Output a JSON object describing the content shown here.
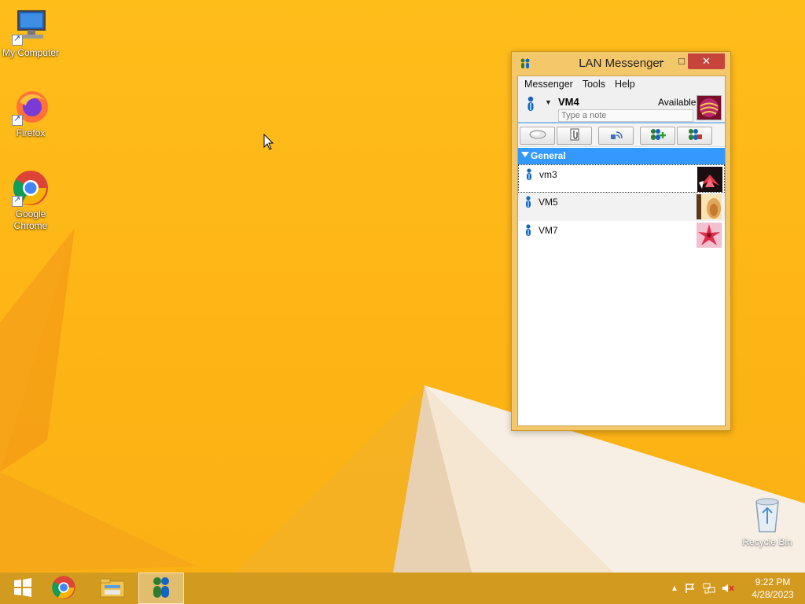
{
  "desktop": {
    "icons": [
      {
        "label": "My Computer",
        "icon": "computer-icon"
      },
      {
        "label": "Firefox",
        "icon": "firefox-icon"
      },
      {
        "label": "Google Chrome",
        "icon": "chrome-icon"
      }
    ],
    "recycle_bin": {
      "label": "Recycle Bin",
      "icon": "recycle-bin-icon"
    }
  },
  "window": {
    "title": "LAN Messenger",
    "controls": {
      "minimize": "–",
      "maximize": "□",
      "close": "✕"
    },
    "menu": [
      "Messenger",
      "Tools",
      "Help"
    ],
    "profile": {
      "name": "VM4",
      "status": "Available",
      "note_placeholder": "Type a note",
      "dropdown": "▼"
    },
    "toolbar_buttons": [
      {
        "icon": "chat-icon"
      },
      {
        "icon": "send-file-icon"
      },
      {
        "icon": "broadcast-icon"
      },
      {
        "icon": "add-contact-icon"
      },
      {
        "icon": "contacts-settings-icon"
      }
    ],
    "group": {
      "name": "General",
      "expanded": true
    },
    "contacts": [
      {
        "name": "vm3",
        "selected": true
      },
      {
        "name": "VM5",
        "selected": false
      },
      {
        "name": "VM7",
        "selected": false
      }
    ]
  },
  "taskbar": {
    "items": [
      {
        "icon": "start-icon"
      },
      {
        "icon": "chrome-icon"
      },
      {
        "icon": "file-explorer-icon"
      },
      {
        "icon": "lan-messenger-icon",
        "active": true
      }
    ],
    "tray": [
      "chevron-up-icon",
      "flag-icon",
      "network-icon",
      "volume-muted-icon"
    ],
    "time": "9:22 PM",
    "date": "4/28/2023"
  },
  "colors": {
    "wallpaper": "#fdb515",
    "window_frame": "#f4c76a",
    "group_header": "#3399ff",
    "close_button": "#c7443c"
  }
}
